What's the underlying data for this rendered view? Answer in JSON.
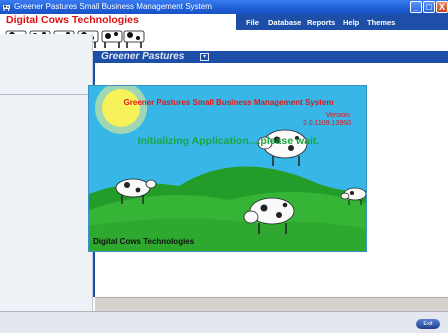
{
  "window": {
    "title": "Greener Pastures Small Business Management System",
    "minimize_label": "_",
    "maximize_label": "□",
    "close_label": "X"
  },
  "header": {
    "company_name": "Digital Cows Technologies"
  },
  "menu": {
    "items": [
      "File",
      "Database",
      "Reports",
      "Help",
      "Themes"
    ]
  },
  "module": {
    "title": "Greener Pastures",
    "dropdown_glyph": "▾"
  },
  "splash": {
    "title": "Greener Pastures Small Business Management System",
    "version_label": "Version:",
    "version": "2.0.1109.13950",
    "status": "Initializing Application....please wait.",
    "company": "Digital Cows Technologies"
  },
  "statusbar": {
    "exit_label": "Exit"
  },
  "colors": {
    "titlebar": "#1f5fd6",
    "menubar": "#1d4fa8",
    "brand_red": "#e01010",
    "splash_sky": "#37b6e8",
    "splash_grass": "#2fa82f",
    "splash_status": "#1aa540"
  },
  "icons": {
    "app": "cow-app-icon",
    "module_dropdown": "chevron-down-icon",
    "sun": "sun-icon"
  }
}
